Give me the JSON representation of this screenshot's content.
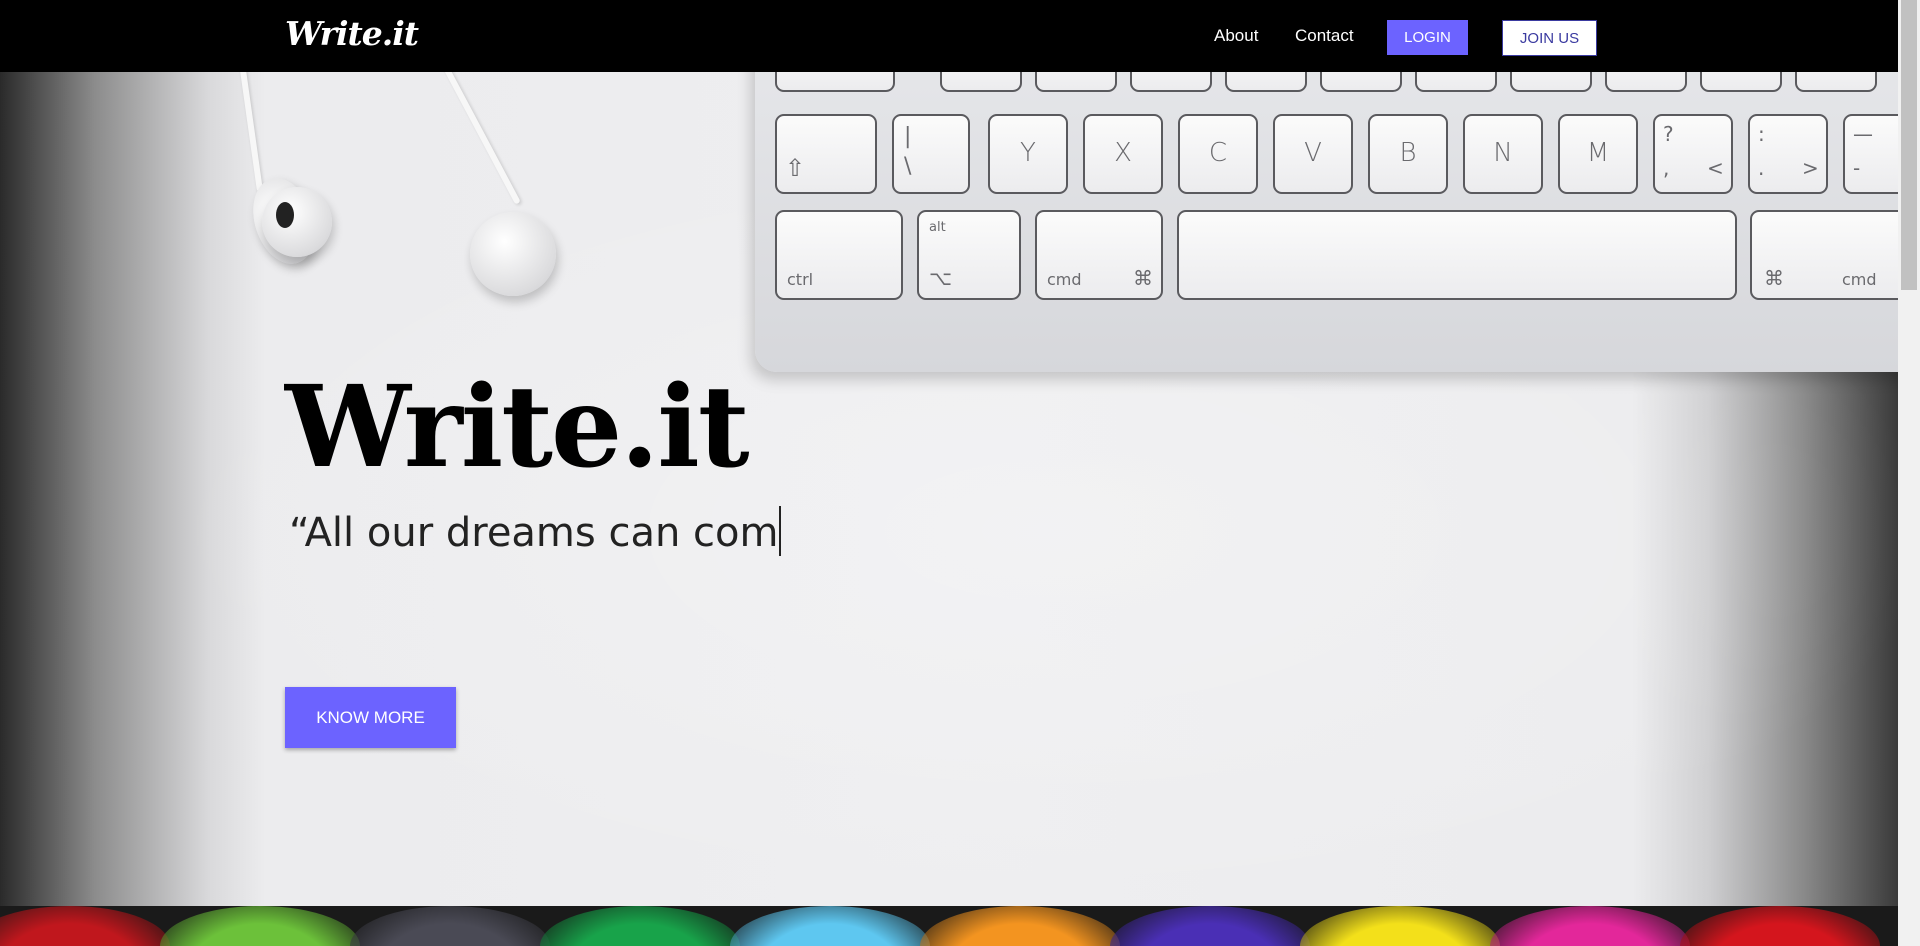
{
  "nav": {
    "brand": "Write.it",
    "about": "About",
    "contact": "Contact",
    "login": "LOGIN",
    "join": "JOIN US"
  },
  "hero": {
    "title": "Write.it",
    "quote": "“All our dreams can com",
    "cta": "KNOW MORE"
  },
  "keyboard": {
    "row1": [
      "",
      "|",
      "Y",
      "X",
      "C",
      "V",
      "B",
      "N",
      "M",
      "?",
      ":",
      "—"
    ],
    "row1_sub": [
      "",
      "\\",
      "",
      "",
      "",
      "",
      "",
      "",
      "",
      ",",
      ".",
      "-"
    ],
    "row1_sub2": [
      "",
      "",
      "",
      "",
      "",
      "",
      "",
      "",
      "",
      "<",
      ">",
      ""
    ],
    "ctrl": "ctrl",
    "alt": "alt",
    "alt_symbol": "⌥",
    "cmd": "cmd",
    "cmd_symbol": "⌘",
    "right_cmd": "cmd",
    "right_cmd_symbol": "⌘",
    "shift_symbol": "⇧"
  },
  "colors": {
    "accent": "#6c63ff",
    "navbar": "#000000",
    "join_text": "#3a3aa0"
  },
  "umbrella_colors": [
    "#c0171d",
    "#6cc13a",
    "#4a4a55",
    "#18a34a",
    "#5ec7f0",
    "#f39420",
    "#4a2fb5",
    "#f3e01a",
    "#e3279a",
    "#d4151d"
  ]
}
